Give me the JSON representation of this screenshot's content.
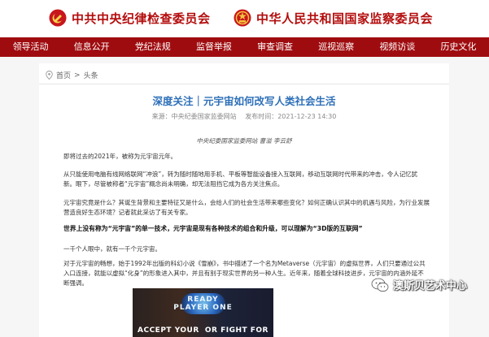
{
  "header": {
    "left_title": "中共中央纪律检查委员会",
    "right_title": "中华人民共和国国家监察委员会",
    "left_emblem_icon": "party-emblem-icon",
    "right_emblem_icon": "national-emblem-icon"
  },
  "nav": {
    "items": [
      {
        "label": "领导活动"
      },
      {
        "label": "信息公开"
      },
      {
        "label": "党纪法规"
      },
      {
        "label": "监督举报"
      },
      {
        "label": "审查调查"
      },
      {
        "label": "巡视巡察"
      },
      {
        "label": "视频访谈"
      },
      {
        "label": "历史文化"
      }
    ]
  },
  "breadcrumb": {
    "home": "首页",
    "separator": ">",
    "current": "头条"
  },
  "article": {
    "title": "深度关注｜元宇宙如何改写人类社会生活",
    "source": "来源：中央纪委国家监委网站",
    "date": "发布时间：2021-12-23 14:30",
    "byline": "中央纪委国家监委网站 曹溢 李云舒",
    "paragraphs": {
      "p1": "即将过去的2021年，被称为元宇宙元年。",
      "p2": "从只能使用电脑有线网络联网“冲浪”，转为随时随地用手机、平板等智能设备接入互联网，移动互联网时代带来的冲击，令人记忆犹新。眼下，尽管被称者“元宇宙”概念尚未明确，却无法阻挡它成为各方关注焦点。",
      "p3": "元宇宙究竟是什么？其诞生背景和主要特征又是什么，会给人们的社会生活带来哪些变化？如何正确认识其中的机遇与风险，为行业发展营造良好生态环境？记者就此采访了有关专家。",
      "p4": "世界上没有称为“元宇宙”的单一技术，元宇宙是现有各种技术的组合和升级，可以理解为“3D版的互联网”",
      "p5": "一千个人眼中，就有一千个元宇宙。",
      "p6": "对于元宇宙的畅想，始于1992年出版的科幻小说《雪崩》，书中描述了一个名为Metaverse（元宇宙）的虚拟世界，人们只要通过公共入口连接，就能以虚拟“化身”的形象进入其中，并且有别于现实世界的另一种人生。近年来，随着全球科技进步，元宇宙的内涵外延不断强调。"
    }
  },
  "banner": {
    "logo_line1": "READY",
    "logo_line2": "PLAYER ONE",
    "caption_left": "ACCEPT YOUR",
    "caption_right": "OR FIGHT FOR"
  },
  "watermark": {
    "text": "澳斯贝艺术中心",
    "icon": "wechat-icon"
  },
  "colors": {
    "brand_red": "#b40d0d",
    "nav_red": "#9f0c0f",
    "title_blue": "#2d6fb8"
  }
}
